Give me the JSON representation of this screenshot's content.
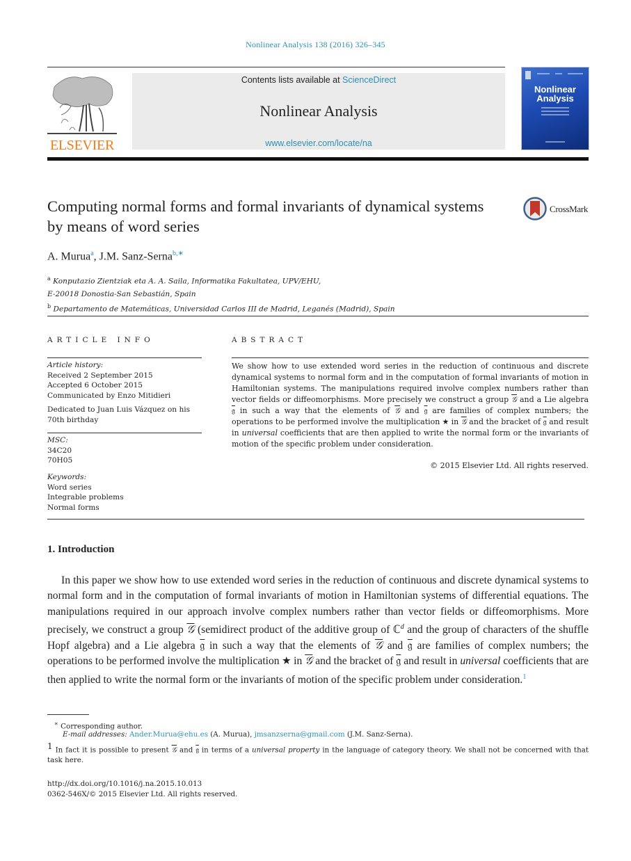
{
  "header": {
    "journal_ref": "Nonlinear Analysis 138 (2016) 326–345",
    "contents_prefix": "Contents lists available at ",
    "contents_link": "ScienceDirect",
    "journal_name": "Nonlinear Analysis",
    "journal_url": "www.elsevier.com/locate/na",
    "publisher_logo_text": "ELSEVIER",
    "cover_title_line1": "Nonlinear",
    "cover_title_line2": "Analysis",
    "crossmark_label": "CrossMark"
  },
  "paper": {
    "title": "Computing normal forms and formal invariants of dynamical systems by means of word series",
    "authors": [
      {
        "name": "A. Murua",
        "marks": "a"
      },
      {
        "name": "J.M. Sanz-Serna",
        "marks": "b,∗"
      }
    ],
    "affiliations": [
      {
        "mark": "a",
        "line1": "Konputazio Zientziak eta A. A. Saila, Informatika Fakultatea, UPV/EHU,",
        "line2": "E-20018 Donostia-San Sebastián, Spain"
      },
      {
        "mark": "b",
        "line1": "Departamento de Matemáticas, Universidad Carlos III de Madrid, Leganés (Madrid), Spain"
      }
    ]
  },
  "article_info": {
    "heading": "ARTICLE INFO",
    "history_label": "Article history:",
    "received": "Received 2 September 2015",
    "accepted": "Accepted 6 October 2015",
    "communicated": "Communicated by Enzo Mitidieri",
    "dedication": "Dedicated to Juan Luis Vázquez on his 70th birthday",
    "msc_label": "MSC:",
    "msc_codes": [
      "34C20",
      "70H05"
    ],
    "keywords_label": "Keywords:",
    "keywords": [
      "Word series",
      "Integrable problems",
      "Normal forms"
    ]
  },
  "abstract": {
    "heading": "ABSTRACT",
    "p1": "We show how to use extended word series in the reduction of continuous and discrete dynamical systems to normal form and in the computation of formal invariants of motion in Hamiltonian systems. The manipulations required involve complex numbers rather than vector fields or diffeomorphisms. More precisely we construct a group ",
    "G": "𝒢",
    "g": "𝔤",
    "p2": " and a Lie algebra ",
    "p3": " in such a way that the elements of ",
    "p4": " and ",
    "p5": " are families of complex numbers; the operations to be performed involve the multiplication ★ in ",
    "p6": " and the bracket of ",
    "p7": " and result in ",
    "universal": "universal",
    "p8": " coefficients that are then applied to write the normal form or the invariants of motion of the specific problem under consideration.",
    "copyright": "© 2015 Elsevier Ltd. All rights reserved."
  },
  "introduction": {
    "heading": "1. Introduction",
    "s1": "In this paper we show how to use extended word series in the reduction of continuous and discrete dynamical systems to normal form and in the computation of formal invariants of motion in Hamiltonian systems of differential equations. The manipulations required in our approach involve complex numbers rather than vector fields or diffeomorphisms. More precisely, we construct a group ",
    "s2": " (semidirect product of the additive group of ℂ",
    "d": "d",
    "s3": " and the group of characters of the shuffle Hopf algebra) and a Lie algebra ",
    "s4": " in such a way that the elements of ",
    "s5": " and ",
    "s6": " are families of complex numbers; the operations to be performed involve the multiplication ★ in ",
    "s7": " and the bracket of ",
    "s8": " and result in ",
    "universal": "universal",
    "s9": " coefficients that are then applied to write the normal form or the invariants of motion of the specific problem under consideration.",
    "footnote_mark": "1"
  },
  "footnotes": {
    "star": "∗",
    "corresponding": "Corresponding author.",
    "email_label": "E-mail addresses:",
    "email1": "Ander.Murua@ehu.es",
    "email1_name": " (A. Murua), ",
    "email2": "jmsanzserna@gmail.com",
    "email2_name": " (J.M. Sanz-Serna).",
    "fn1_mark": "1",
    "fn1_a": "In fact it is possible to present ",
    "fn1_b": " and ",
    "fn1_c": " in terms of a ",
    "fn1_italic": "universal property",
    "fn1_d": " in the language of category theory. We shall not be concerned with that task here.",
    "doi": "http://dx.doi.org/10.1016/j.na.2015.10.013",
    "issn": "0362-546X/© 2015 Elsevier Ltd. All rights reserved."
  },
  "colors": {
    "link": "#2d8fb4",
    "elsevier_orange": "#f07d1a",
    "cover_blue": "#1d4ab2",
    "header_box": "#ebebeb"
  }
}
